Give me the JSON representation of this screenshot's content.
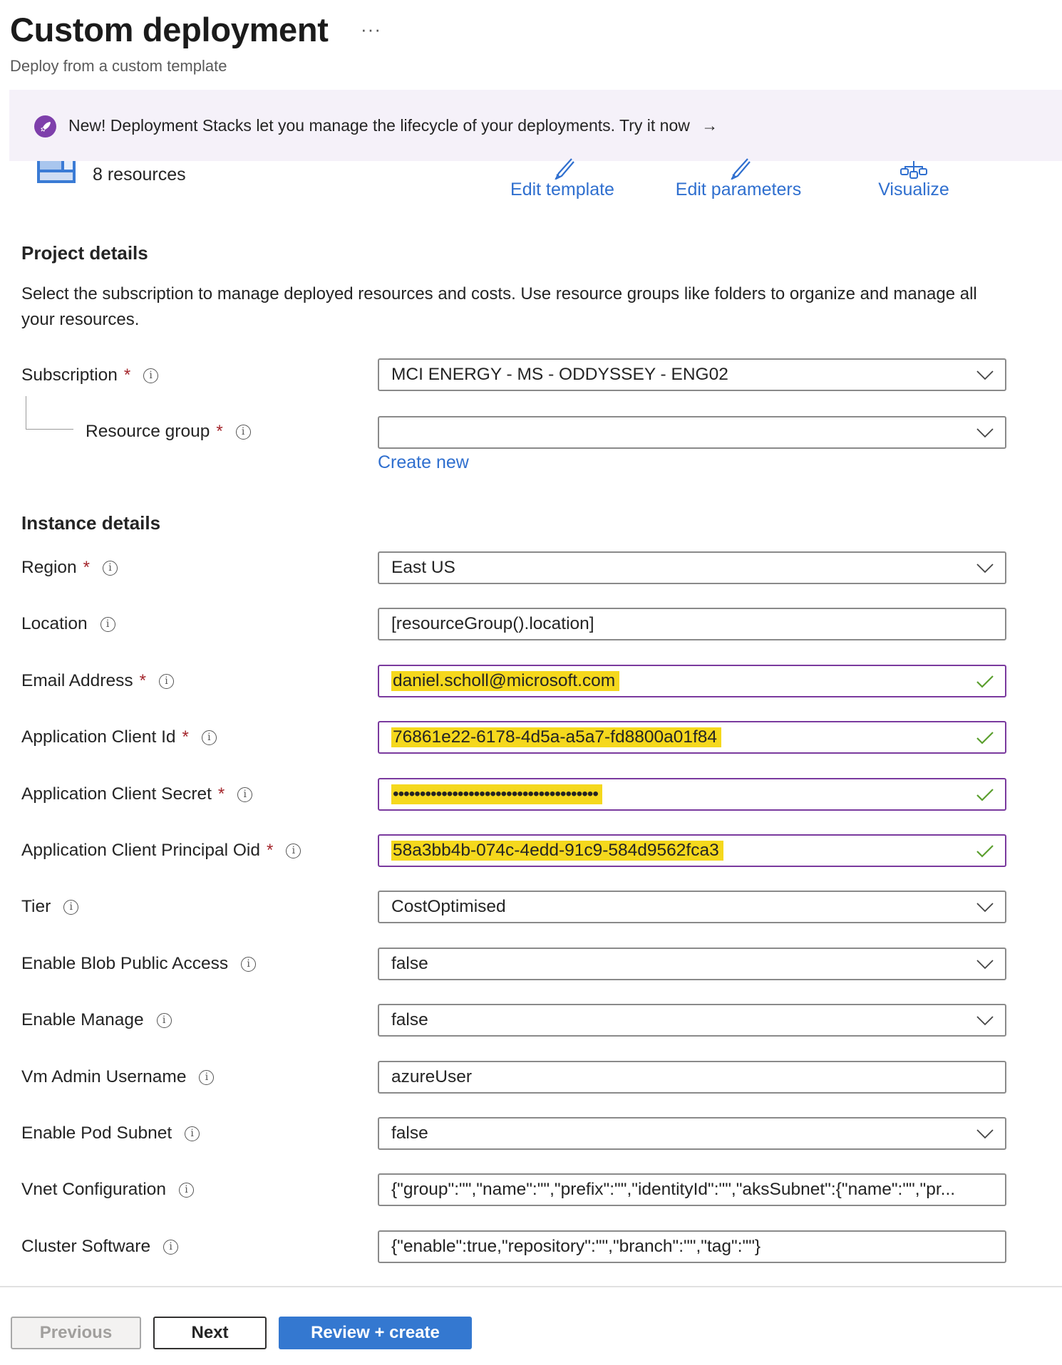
{
  "header": {
    "title": "Custom deployment",
    "more_label": "···",
    "subtitle": "Deploy from a custom template"
  },
  "banner": {
    "text": "New! Deployment Stacks let you manage the lifecycle of your deployments. Try it now",
    "arrow": "→",
    "icon": "rocket-icon"
  },
  "template_summary": {
    "resources_label": "8 resources",
    "actions": [
      {
        "label": "Edit template",
        "icon": "pencil-icon"
      },
      {
        "label": "Edit parameters",
        "icon": "pencil-icon"
      },
      {
        "label": "Visualize",
        "icon": "hierarchy-icon"
      }
    ]
  },
  "project_details": {
    "heading": "Project details",
    "description": "Select the subscription to manage deployed resources and costs. Use resource groups like folders to organize and manage all your resources.",
    "subscription": {
      "label": "Subscription",
      "required": "*",
      "value": "MCI ENERGY - MS - ODDYSSEY - ENG02"
    },
    "resource_group": {
      "label": "Resource group",
      "required": "*",
      "value": "",
      "create_new": "Create new"
    }
  },
  "instance_details": {
    "heading": "Instance details",
    "fields": [
      {
        "label": "Region",
        "required": "*",
        "value": "East US",
        "type": "dropdown"
      },
      {
        "label": "Location",
        "required": "",
        "value": "[resourceGroup().location]",
        "type": "text"
      },
      {
        "label": "Email Address",
        "required": "*",
        "value": "daniel.scholl@microsoft.com",
        "type": "text",
        "valid": true,
        "highlighted": true
      },
      {
        "label": "Application Client Id",
        "required": "*",
        "value": "76861e22-6178-4d5a-a5a7-fd8800a01f84",
        "type": "text",
        "valid": true,
        "highlighted": true
      },
      {
        "label": "Application Client Secret",
        "required": "*",
        "value": "••••••••••••••••••••••••••••••••••••••",
        "type": "password",
        "valid": true,
        "highlighted": true
      },
      {
        "label": "Application Client Principal Oid",
        "required": "*",
        "value": "58a3bb4b-074c-4edd-91c9-584d9562fca3",
        "type": "text",
        "valid": true,
        "highlighted": true
      },
      {
        "label": "Tier",
        "required": "",
        "value": "CostOptimised",
        "type": "dropdown"
      },
      {
        "label": "Enable Blob Public Access",
        "required": "",
        "value": "false",
        "type": "dropdown"
      },
      {
        "label": "Enable Manage",
        "required": "",
        "value": "false",
        "type": "dropdown"
      },
      {
        "label": "Vm Admin Username",
        "required": "",
        "value": "azureUser",
        "type": "text"
      },
      {
        "label": "Enable Pod Subnet",
        "required": "",
        "value": "false",
        "type": "dropdown"
      },
      {
        "label": "Vnet Configuration",
        "required": "",
        "value": "{\"group\":\"\",\"name\":\"\",\"prefix\":\"\",\"identityId\":\"\",\"aksSubnet\":{\"name\":\"\",\"pr...",
        "type": "text"
      },
      {
        "label": "Cluster Software",
        "required": "",
        "value": "{\"enable\":true,\"repository\":\"\",\"branch\":\"\",\"tag\":\"\"}",
        "type": "text"
      }
    ]
  },
  "footer": {
    "previous_label": "Previous",
    "next_label": "Next",
    "review_label": "Review + create"
  },
  "colors": {
    "accent": "#3478d0",
    "link": "#2f6fcf",
    "valid_border": "#7a3a9e",
    "valid_check": "#5b9f2e",
    "highlight": "#f5d81d",
    "required": "#a4262c",
    "banner_bg": "#f5f1f9",
    "banner_icon": "#7e3fab"
  }
}
